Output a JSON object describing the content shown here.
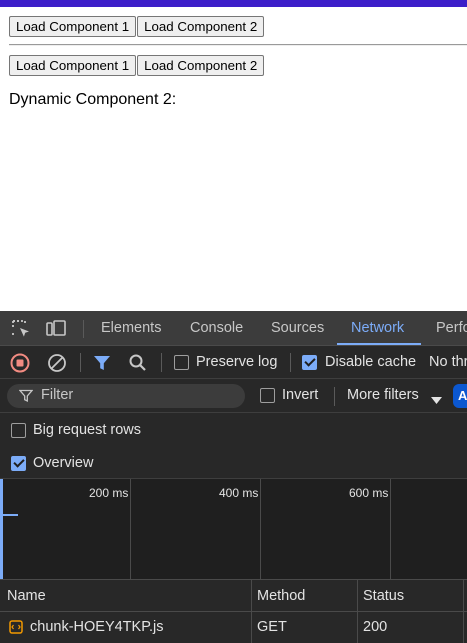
{
  "page": {
    "row1": {
      "btn1": "Load Component 1",
      "btn2": "Load Component 2"
    },
    "row2": {
      "btn1": "Load Component 1",
      "btn2": "Load Component 2"
    },
    "dynamic_label": "Dynamic Component 2:",
    "accent_color": "#3c1ec9"
  },
  "devtools": {
    "tabs": [
      "Elements",
      "Console",
      "Sources",
      "Network",
      "Perfo"
    ],
    "active_tab": "Network",
    "toolbar": {
      "preserve_log": "Preserve log",
      "preserve_log_checked": false,
      "disable_cache": "Disable cache",
      "disable_cache_checked": true,
      "throttle": "No thr"
    },
    "filter": {
      "placeholder": "Filter",
      "invert": "Invert",
      "invert_checked": false,
      "more_filters": "More filters",
      "all_chip": "A"
    },
    "options": {
      "big_request_rows": "Big request rows",
      "big_request_rows_checked": false,
      "overview": "Overview",
      "overview_checked": true
    },
    "timeline": {
      "ticks": [
        "200 ms",
        "400 ms",
        "600 ms"
      ]
    },
    "table": {
      "headers": {
        "name": "Name",
        "method": "Method",
        "status": "Status"
      },
      "rows": [
        {
          "name": "chunk-HOEY4TKP.js",
          "method": "GET",
          "status": "200"
        }
      ]
    },
    "colors": {
      "accent": "#7cacf8",
      "record": "#f28b82",
      "bg": "#282828"
    }
  }
}
